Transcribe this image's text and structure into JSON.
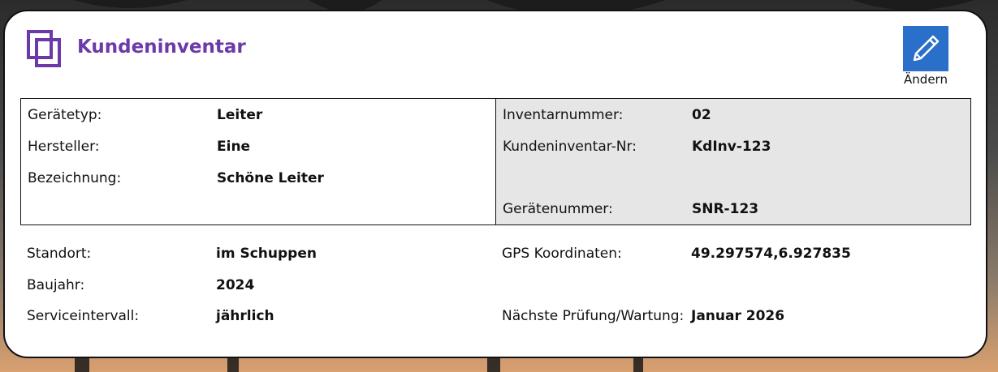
{
  "header": {
    "title": "Kundeninventar",
    "icon": "copy-icon",
    "edit_label": "Ändern",
    "edit_icon": "pencil-icon"
  },
  "colors": {
    "title": "#6b3aa8",
    "edit_button": "#2a6fc9",
    "right_panel": "#e6e6e6"
  },
  "left_box": [
    {
      "label": "Gerätetyp:",
      "value": "Leiter"
    },
    {
      "label": "Hersteller:",
      "value": "Eine"
    },
    {
      "label": "Bezeichnung:",
      "value": "Schöne Leiter"
    }
  ],
  "right_box": [
    {
      "label": "Inventarnummer:",
      "value": "02"
    },
    {
      "label": "Kundeninventar-Nr:",
      "value": "KdInv-123"
    },
    {
      "label": "Gerätenummer:",
      "value": "SNR-123"
    }
  ],
  "details_left": [
    {
      "label": "Standort:",
      "value": "im Schuppen"
    },
    {
      "label": "Baujahr:",
      "value": "2024"
    },
    {
      "label": "Serviceintervall:",
      "value": "jährlich"
    }
  ],
  "details_right": [
    {
      "label": "GPS Koordinaten:",
      "value": "49.297574,6.927835"
    },
    {
      "label": "Nächste Prüfung/Wartung:",
      "value": "Januar 2026"
    }
  ]
}
